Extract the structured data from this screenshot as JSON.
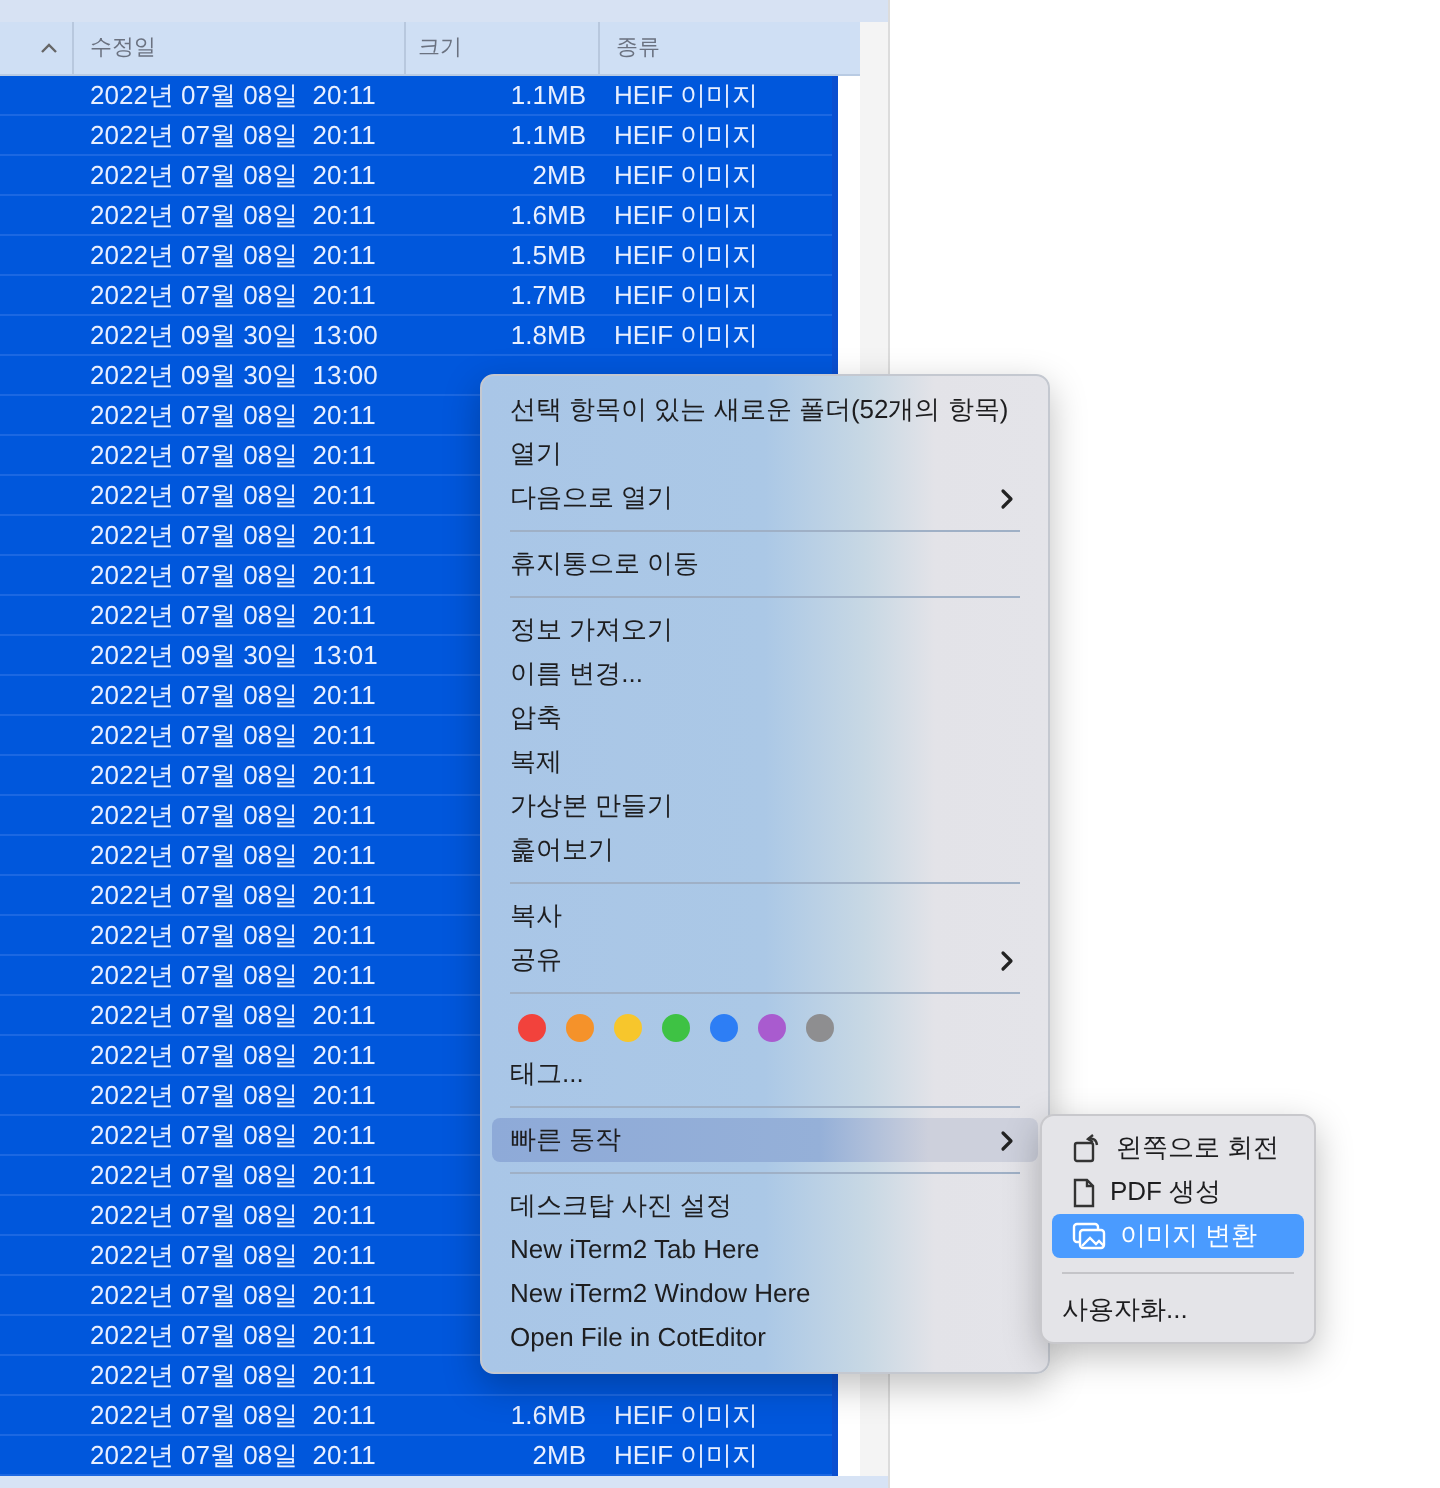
{
  "table": {
    "columns": [
      "수정일",
      "크기",
      "종류"
    ],
    "rows": [
      {
        "date": "2022년 07월 08일  20:11",
        "size": "1.1MB",
        "kind": "HEIF 이미지",
        "selected": true
      },
      {
        "date": "2022년 07월 08일  20:11",
        "size": "1.1MB",
        "kind": "HEIF 이미지",
        "selected": true
      },
      {
        "date": "2022년 07월 08일  20:11",
        "size": "2MB",
        "kind": "HEIF 이미지",
        "selected": true
      },
      {
        "date": "2022년 07월 08일  20:11",
        "size": "1.6MB",
        "kind": "HEIF 이미지",
        "selected": true
      },
      {
        "date": "2022년 07월 08일  20:11",
        "size": "1.5MB",
        "kind": "HEIF 이미지",
        "selected": true
      },
      {
        "date": "2022년 07월 08일  20:11",
        "size": "1.7MB",
        "kind": "HEIF 이미지",
        "selected": true
      },
      {
        "date": "2022년 09월 30일  13:00",
        "size": "1.8MB",
        "kind": "HEIF 이미지",
        "selected": true
      },
      {
        "date": "2022년 09월 30일  13:00",
        "selected": true
      },
      {
        "date": "2022년 07월 08일  20:11",
        "selected": true
      },
      {
        "date": "2022년 07월 08일  20:11",
        "selected": true
      },
      {
        "date": "2022년 07월 08일  20:11",
        "selected": true
      },
      {
        "date": "2022년 07월 08일  20:11",
        "selected": true
      },
      {
        "date": "2022년 07월 08일  20:11",
        "selected": true
      },
      {
        "date": "2022년 07월 08일  20:11",
        "selected": true
      },
      {
        "date": "2022년 09월 30일  13:01",
        "selected": true
      },
      {
        "date": "2022년 07월 08일  20:11",
        "selected": true
      },
      {
        "date": "2022년 07월 08일  20:11",
        "selected": true
      },
      {
        "date": "2022년 07월 08일  20:11",
        "selected": true
      },
      {
        "date": "2022년 07월 08일  20:11",
        "selected": true
      },
      {
        "date": "2022년 07월 08일  20:11",
        "selected": true
      },
      {
        "date": "2022년 07월 08일  20:11",
        "selected": true
      },
      {
        "date": "2022년 07월 08일  20:11",
        "selected": true
      },
      {
        "date": "2022년 07월 08일  20:11",
        "selected": true
      },
      {
        "date": "2022년 07월 08일  20:11",
        "selected": true
      },
      {
        "date": "2022년 07월 08일  20:11",
        "selected": true
      },
      {
        "date": "2022년 07월 08일  20:11",
        "selected": true
      },
      {
        "date": "2022년 07월 08일  20:11",
        "selected": true
      },
      {
        "date": "2022년 07월 08일  20:11",
        "selected": true
      },
      {
        "date": "2022년 07월 08일  20:11",
        "selected": true
      },
      {
        "date": "2022년 07월 08일  20:11",
        "selected": true
      },
      {
        "date": "2022년 07월 08일  20:11",
        "selected": true
      },
      {
        "date": "2022년 07월 08일  20:11",
        "selected": true
      },
      {
        "date": "2022년 07월 08일  20:11",
        "selected": true
      },
      {
        "date": "2022년 07월 08일  20:11",
        "size": "1.6MB",
        "kind": "HEIF 이미지",
        "selected": true
      },
      {
        "date": "2022년 07월 08일  20:11",
        "size": "2MB",
        "kind": "HEIF 이미지",
        "selected": true
      }
    ]
  },
  "context_menu": {
    "items": [
      {
        "kind": "item",
        "label": "선택 항목이 있는 새로운 폴더(52개의 항목)",
        "submenu": false,
        "selected": false
      },
      {
        "kind": "item",
        "label": "열기",
        "submenu": false,
        "selected": false
      },
      {
        "kind": "item",
        "label": "다음으로 열기",
        "submenu": true,
        "selected": false
      },
      {
        "kind": "separator"
      },
      {
        "kind": "item",
        "label": "휴지통으로 이동",
        "submenu": false,
        "selected": false
      },
      {
        "kind": "separator"
      },
      {
        "kind": "item",
        "label": "정보 가져오기",
        "submenu": false,
        "selected": false
      },
      {
        "kind": "item",
        "label": "이름 변경...",
        "submenu": false,
        "selected": false
      },
      {
        "kind": "item",
        "label": "압축",
        "submenu": false,
        "selected": false
      },
      {
        "kind": "item",
        "label": "복제",
        "submenu": false,
        "selected": false
      },
      {
        "kind": "item",
        "label": "가상본 만들기",
        "submenu": false,
        "selected": false
      },
      {
        "kind": "item",
        "label": "훑어보기",
        "submenu": false,
        "selected": false
      },
      {
        "kind": "separator"
      },
      {
        "kind": "item",
        "label": "복사",
        "submenu": false,
        "selected": false
      },
      {
        "kind": "item",
        "label": "공유",
        "submenu": true,
        "selected": false
      },
      {
        "kind": "separator"
      },
      {
        "kind": "tags",
        "tags": [
          {
            "color": "#f2423c"
          },
          {
            "color": "#f5922a"
          },
          {
            "color": "#f7c62c"
          },
          {
            "color": "#3ec244"
          },
          {
            "color": "#2d7ef5"
          },
          {
            "color": "#a95bcf"
          },
          {
            "color": "#8e8e90"
          }
        ]
      },
      {
        "kind": "item",
        "label": "태그...",
        "submenu": false,
        "selected": false
      },
      {
        "kind": "separator"
      },
      {
        "kind": "item",
        "label": "빠른 동작",
        "submenu": true,
        "selected": true
      },
      {
        "kind": "separator"
      },
      {
        "kind": "item",
        "label": "데스크탑 사진 설정",
        "submenu": false,
        "selected": false
      },
      {
        "kind": "item",
        "label": "New iTerm2 Tab Here",
        "submenu": false,
        "selected": false
      },
      {
        "kind": "item",
        "label": "New iTerm2 Window Here",
        "submenu": false,
        "selected": false
      },
      {
        "kind": "item",
        "label": "Open File in CotEditor",
        "submenu": false,
        "selected": false
      }
    ]
  },
  "submenu": {
    "items": [
      {
        "kind": "rotate",
        "label": "왼쪽으로 회전",
        "selected": false
      },
      {
        "kind": "pdf",
        "label": "PDF 생성",
        "selected": false
      },
      {
        "kind": "photos",
        "label": "이미지 변환",
        "selected": true
      },
      {
        "kind": "separator"
      },
      {
        "kind": "plain",
        "label": "사용자화...",
        "selected": false
      }
    ]
  }
}
